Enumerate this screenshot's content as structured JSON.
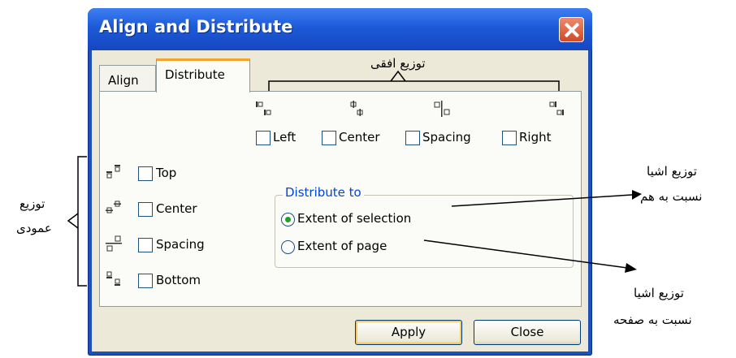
{
  "dialog": {
    "title": "Align and Distribute",
    "tabs": [
      {
        "label": "Align",
        "active": false
      },
      {
        "label": "Distribute",
        "active": true
      }
    ],
    "horizontal": [
      {
        "label": "Left",
        "icon": "distribute-left-icon",
        "checked": false
      },
      {
        "label": "Center",
        "icon": "distribute-center-h-icon",
        "checked": false
      },
      {
        "label": "Spacing",
        "icon": "distribute-spacing-h-icon",
        "checked": false
      },
      {
        "label": "Right",
        "icon": "distribute-right-icon",
        "checked": false
      }
    ],
    "vertical": [
      {
        "label": "Top",
        "icon": "distribute-top-icon",
        "checked": false
      },
      {
        "label": "Center",
        "icon": "distribute-center-v-icon",
        "checked": false
      },
      {
        "label": "Spacing",
        "icon": "distribute-spacing-v-icon",
        "checked": false
      },
      {
        "label": "Bottom",
        "icon": "distribute-bottom-icon",
        "checked": false
      }
    ],
    "distribute_to": {
      "title": "Distribute to",
      "options": [
        {
          "label": "Extent of selection",
          "checked": true
        },
        {
          "label": "Extent of page",
          "checked": false
        }
      ]
    },
    "buttons": {
      "apply": "Apply",
      "close": "Close"
    }
  },
  "annotations": {
    "horizontal_distribution": "توزیع افقی",
    "vertical_distribution": [
      "توزیع",
      "عمودی"
    ],
    "relative_to_each_other": [
      "توزیع اشیا",
      "نسبت به هم"
    ],
    "relative_to_page": [
      "توزیع اشیا",
      "نسبت به صفحه"
    ]
  },
  "colors": {
    "titlebar": "#1c5ad8",
    "close_button": "#d24a26",
    "dialog_face": "#ece9d8",
    "active_tab_accent": "#f3a42a",
    "group_title": "#0046d5",
    "radio_dot": "#21a121"
  }
}
